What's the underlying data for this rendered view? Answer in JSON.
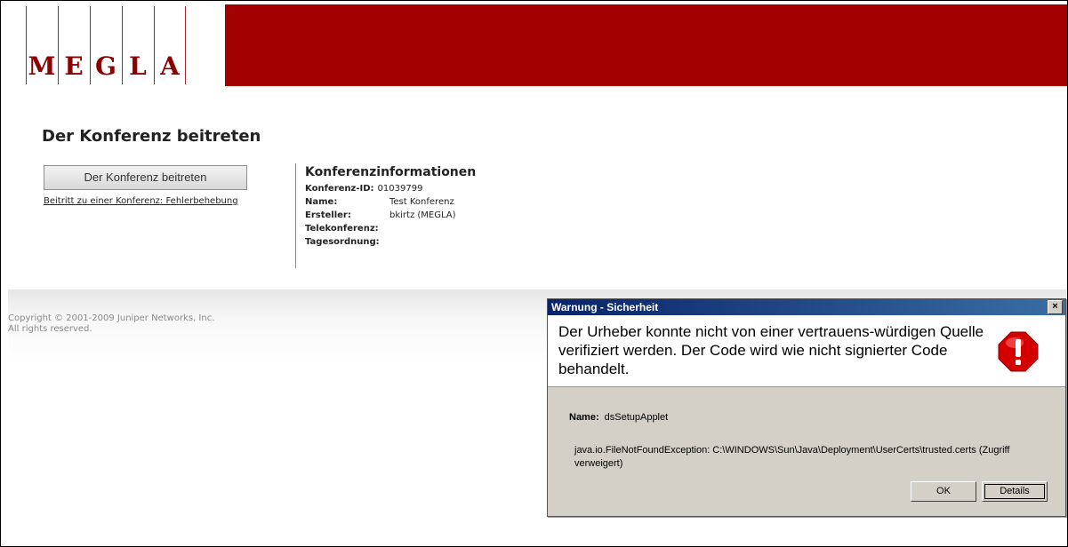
{
  "header": {
    "logo_letters": [
      "M",
      "E",
      "G",
      "L",
      "A"
    ],
    "brand_color": "#a30000"
  },
  "main": {
    "page_title": "Der Konferenz beitreten",
    "join_button_label": "Der Konferenz beitreten",
    "troubleshoot_link": "Beitritt zu einer Konferenz: Fehlerbehebung",
    "info": {
      "title": "Konferenzinformationen",
      "rows": [
        {
          "label": "Konferenz-ID:",
          "value": "01039799"
        },
        {
          "label": "Name:",
          "value": "Test Konferenz"
        },
        {
          "label": "Ersteller:",
          "value": "bkirtz (MEGLA)"
        },
        {
          "label": "Telekonferenz:",
          "value": ""
        },
        {
          "label": "Tagesordnung:",
          "value": ""
        }
      ]
    }
  },
  "footer": {
    "copyright_line1": "Copyright © 2001-2009 Juniper Networks, Inc.",
    "copyright_line2": "All rights reserved."
  },
  "dialog": {
    "title": "Warnung - Sicherheit",
    "close_glyph": "×",
    "message": "Der Urheber konnte nicht von einer vertrauens-würdigen Quelle verifiziert werden. Der Code wird wie nicht signierter Code behandelt.",
    "name_label": "Name:",
    "name_value": "dsSetupApplet",
    "exception": "java.io.FileNotFoundException: C:\\WINDOWS\\Sun\\Java\\Deployment\\UserCerts\\trusted.certs (Zugriff verweigert)",
    "ok_label": "OK",
    "details_label": "Details",
    "icon": "warning-exclamation-icon"
  }
}
